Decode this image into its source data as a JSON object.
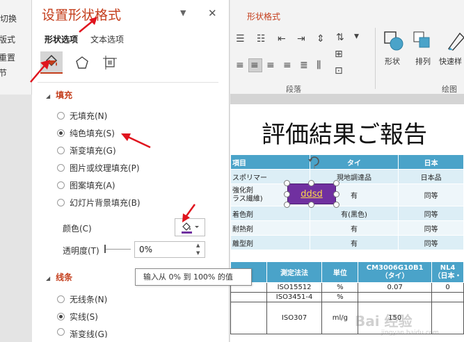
{
  "left_ribbon": {
    "items": [
      "切换",
      "版式",
      "重置",
      "节"
    ]
  },
  "pane": {
    "title": "设置形状格式",
    "tabs": {
      "shape_options": "形状选项",
      "text_options": "文本选项"
    },
    "fill": {
      "heading": "填充",
      "options": [
        "无填充(N)",
        "纯色填充(S)",
        "渐变填充(G)",
        "图片或纹理填充(P)",
        "图案填充(A)",
        "幻灯片背景填充(B)"
      ],
      "selected_index": 1,
      "color_label": "颜色(C)",
      "transparency_label": "透明度(T)",
      "transparency_value": "0%"
    },
    "tooltip": "输入从 0% 到 100% 的值",
    "line": {
      "heading": "线条",
      "options": [
        "无线条(N)",
        "实线(S)",
        "渐变线(G)"
      ],
      "selected_index": 1
    }
  },
  "ribbon": {
    "tab": "形状格式",
    "groups": {
      "paragraph": "段落",
      "drawing": "绘图"
    },
    "buttons": {
      "shape": "形状",
      "arrange": "排列",
      "quick_styles": "快速样"
    }
  },
  "slide": {
    "title": "評価結果ご報告",
    "table1": {
      "headers": [
        "項目",
        "タイ",
        "日本"
      ],
      "rows": [
        [
          "スポリマー",
          "現地調達品",
          "日本品"
        ],
        [
          "強化剤\nラス繊維)",
          "有",
          "同等"
        ],
        [
          "着色剤",
          "有(黒色)",
          "同等"
        ],
        [
          "耐熱剤",
          "有",
          "同等"
        ],
        [
          "離型剤",
          "有",
          "同等"
        ]
      ]
    },
    "shape_text": "ddsd",
    "table2": {
      "headers": [
        "",
        "測定法法",
        "単位",
        "CM3006G10B1\n（タイ）",
        "NL4\n（日本・"
      ],
      "rows": [
        [
          "",
          "ISO15512",
          "%",
          "0.07",
          "0"
        ],
        [
          "",
          "ISO3451-4",
          "%",
          "",
          ""
        ],
        [
          "",
          "ISO307",
          "ml/g",
          "150",
          ""
        ]
      ]
    }
  },
  "watermark": {
    "main": "Bai 经验",
    "sub": "jingyan.baidu.com"
  },
  "colors": {
    "accent": "#c43e1c",
    "table_header": "#4aa3c9",
    "shape_fill": "#7030a0",
    "shape_text": "#ffd84a",
    "annotation": "#e0141e"
  }
}
